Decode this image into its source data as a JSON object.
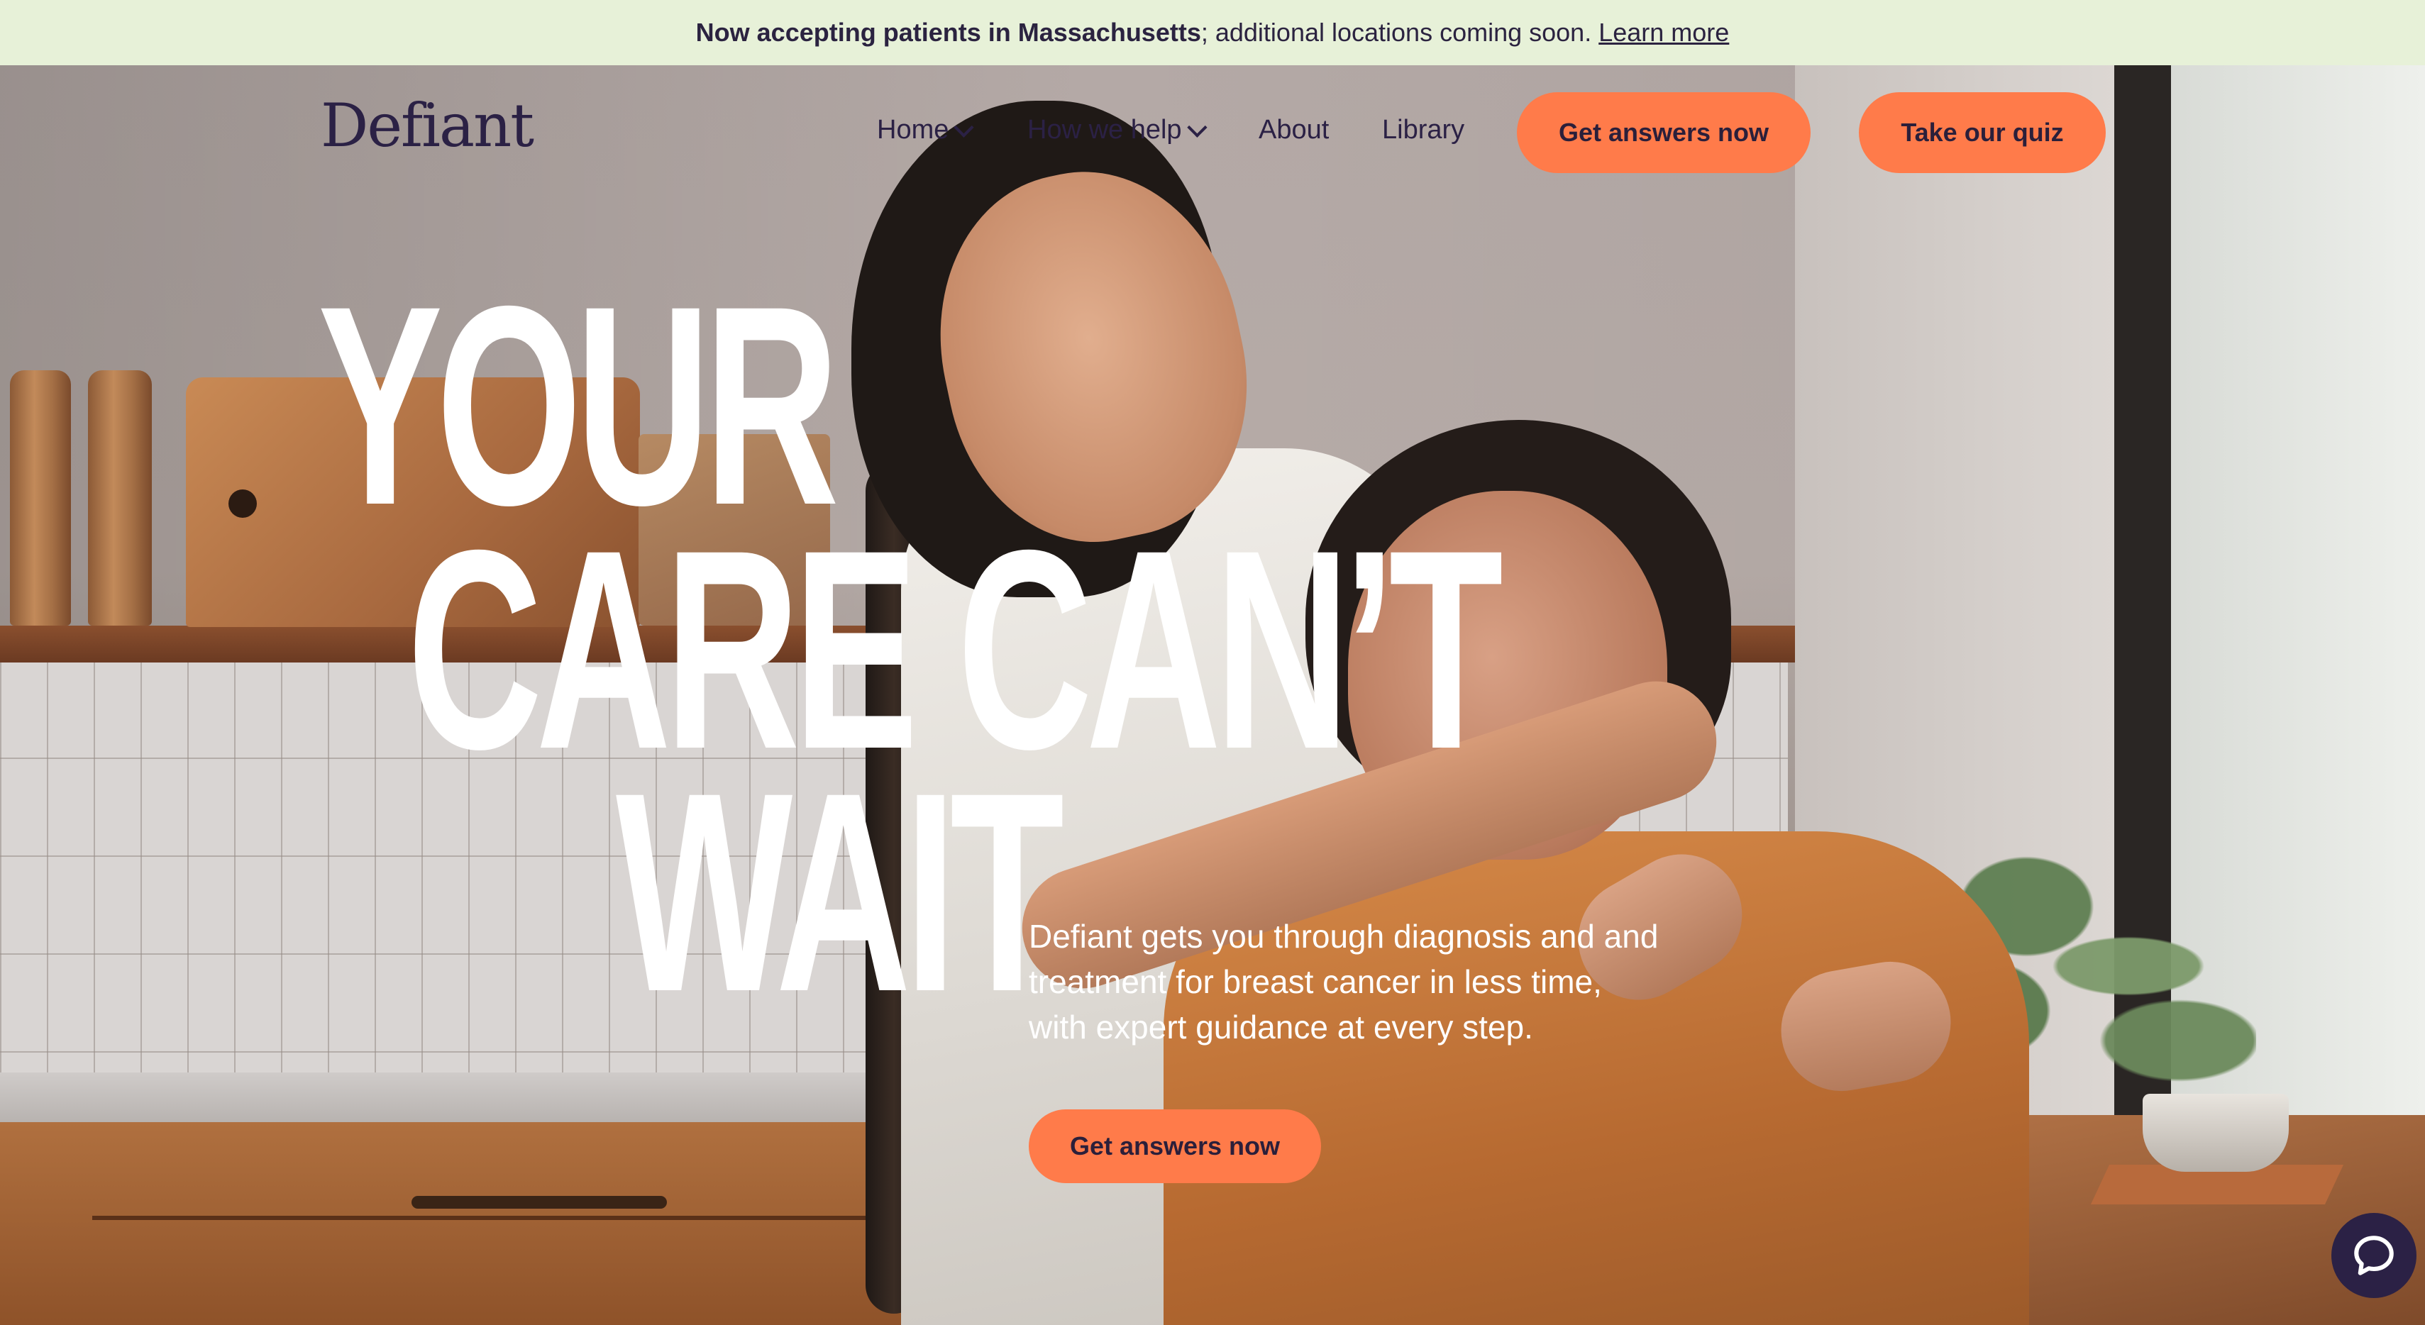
{
  "announcement": {
    "bold": "Now accepting patients in Massachusetts",
    "rest": "; additional locations coming soon.",
    "link": "Learn more"
  },
  "nav": {
    "logo": "Defiant",
    "links": [
      {
        "label": "Home",
        "has_dropdown": true
      },
      {
        "label": "How we help",
        "has_dropdown": true
      },
      {
        "label": "About",
        "has_dropdown": false
      },
      {
        "label": "Library",
        "has_dropdown": false
      }
    ],
    "cta_primary": "Get answers now",
    "cta_secondary": "Take our quiz"
  },
  "hero": {
    "headline_line1": "YOUR",
    "headline_line2": "CARE CAN’T",
    "headline_line3": "WAIT",
    "subtext": "Defiant gets you through diagnosis and and treatment for breast cancer in less time, with expert guidance at every step.",
    "cta": "Get answers now"
  },
  "chat_widget": {
    "icon": "chat-bubble-icon"
  },
  "colors": {
    "announcement_bg": "#e7f1d8",
    "brand_dark": "#2b2145",
    "accent": "#ff7b4a",
    "headline": "#ffffff"
  }
}
